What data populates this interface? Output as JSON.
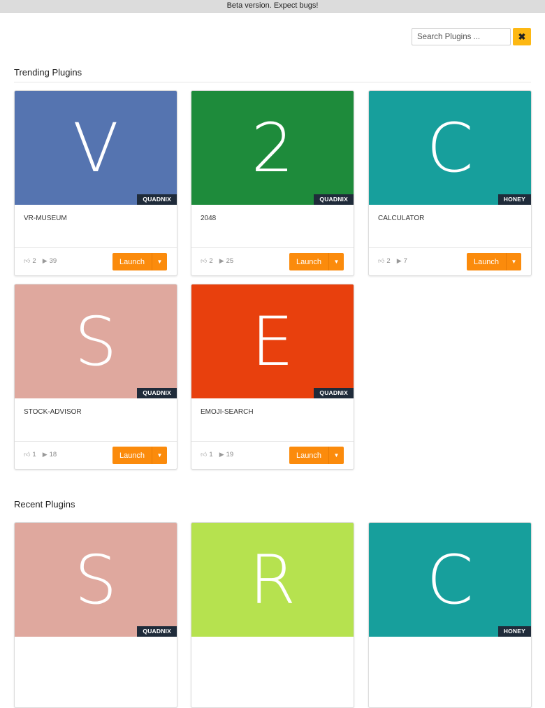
{
  "banner": "Beta version. Expect bugs!",
  "search": {
    "placeholder": "Search Plugins ...",
    "value": "",
    "clear_label": "✖"
  },
  "sections": [
    {
      "title": "Trending Plugins",
      "cards": [
        {
          "letter": "V",
          "bg": "#5574b0",
          "author": "QUADNIX",
          "name": "VR-MUSEUM",
          "likes": "2",
          "plays": "39",
          "launch": "Launch"
        },
        {
          "letter": "2",
          "bg": "#1e8b3b",
          "author": "QUADNIX",
          "name": "2048",
          "likes": "2",
          "plays": "25",
          "launch": "Launch"
        },
        {
          "letter": "C",
          "bg": "#179f9c",
          "author": "HONEY",
          "name": "CALCULATOR",
          "likes": "2",
          "plays": "7",
          "launch": "Launch"
        },
        {
          "letter": "S",
          "bg": "#dfa89e",
          "author": "QUADNIX",
          "name": "STOCK-ADVISOR",
          "likes": "1",
          "plays": "18",
          "launch": "Launch"
        },
        {
          "letter": "E",
          "bg": "#e8400d",
          "author": "QUADNIX",
          "name": "EMOJI-SEARCH",
          "likes": "1",
          "plays": "19",
          "launch": "Launch"
        }
      ]
    },
    {
      "title": "Recent Plugins",
      "cards": [
        {
          "letter": "S",
          "bg": "#dfa89e",
          "author": "QUADNIX",
          "name": "",
          "likes": "",
          "plays": "",
          "launch": ""
        },
        {
          "letter": "R",
          "bg": "#b6e24f",
          "author": "",
          "name": "",
          "likes": "",
          "plays": "",
          "launch": ""
        },
        {
          "letter": "C",
          "bg": "#179f9c",
          "author": "HONEY",
          "name": "",
          "likes": "",
          "plays": "",
          "launch": ""
        }
      ]
    }
  ],
  "icons": {
    "like": "thumbs-up-icon",
    "play": "play-icon",
    "caret": "caret-down-icon"
  }
}
